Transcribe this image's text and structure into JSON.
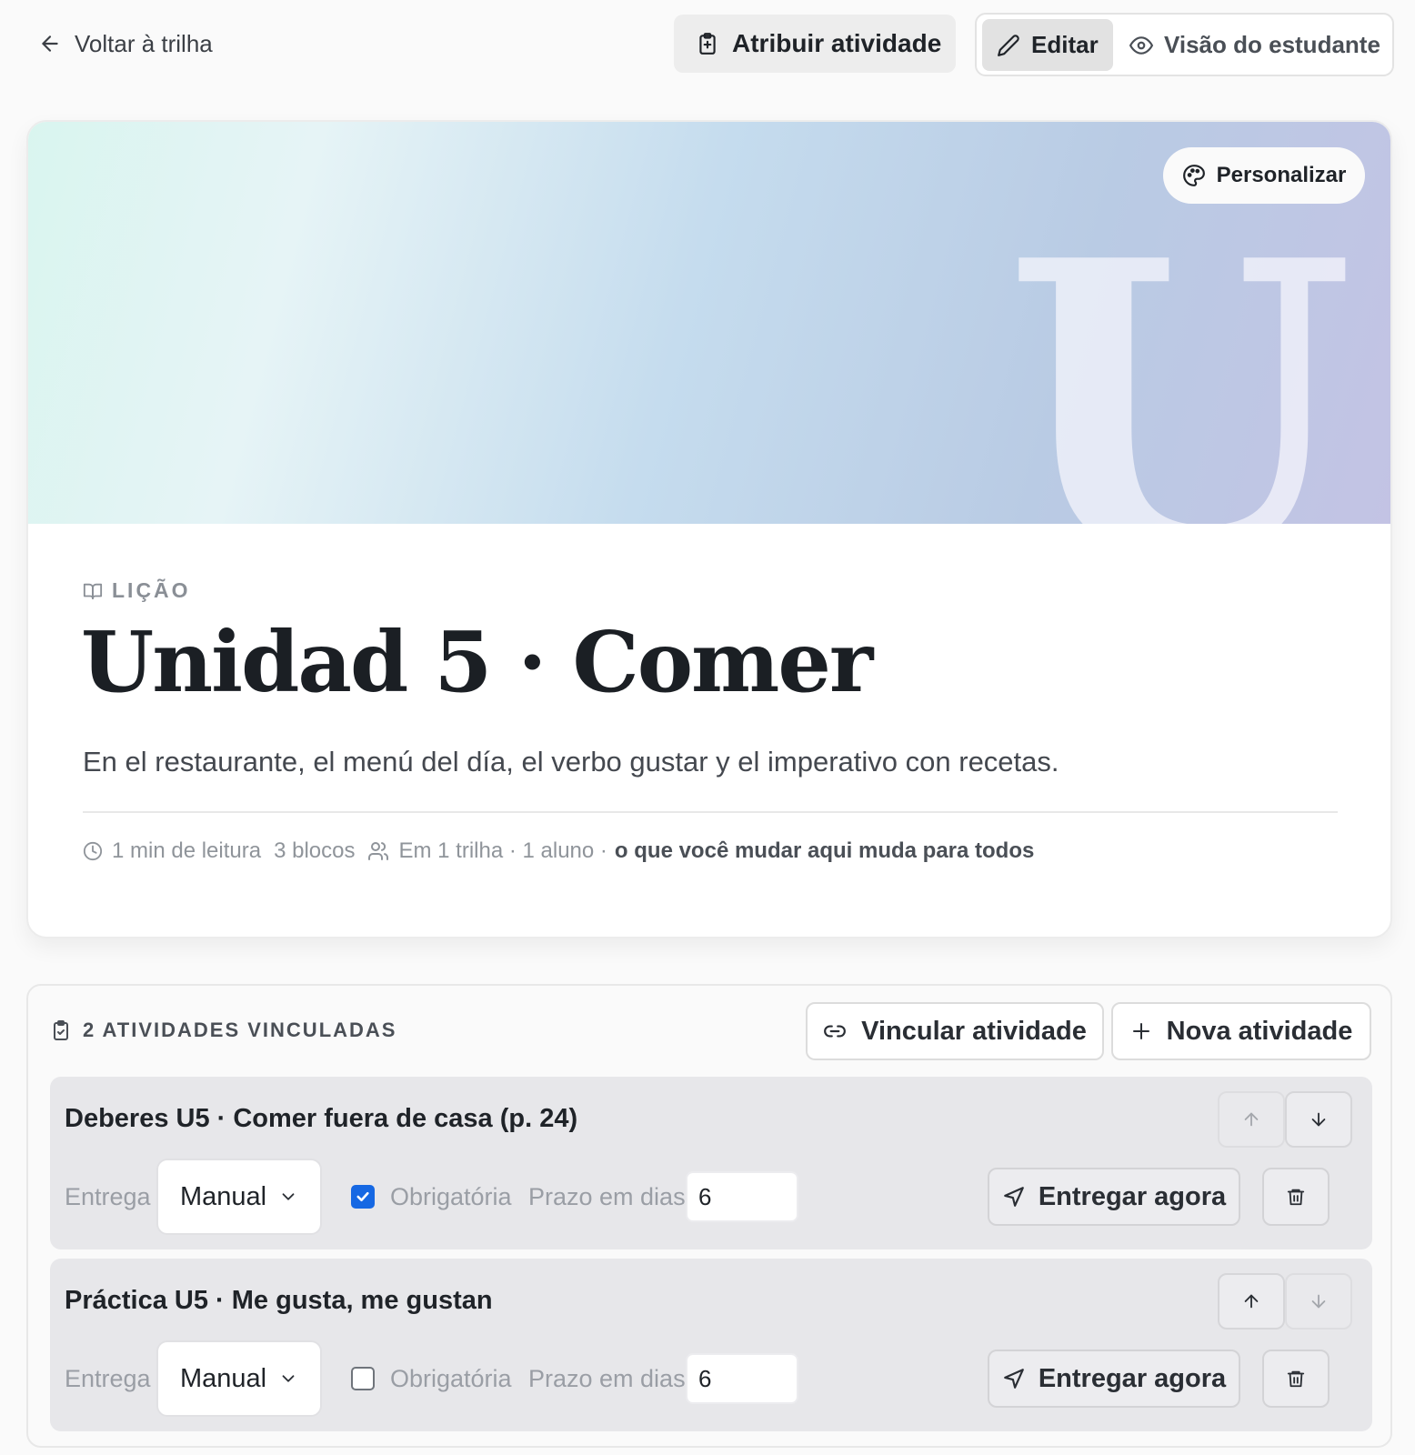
{
  "topbar": {
    "back_label": "Voltar à trilha",
    "back_icon": "arrow-left-icon",
    "assign_label": "Atribuir atividade",
    "assign_icon": "clipboard-plus-icon",
    "mode": {
      "edit_label": "Editar",
      "edit_icon": "pencil-icon",
      "edit_active": true,
      "student_label": "Visão do estudante",
      "student_icon": "eye-icon"
    }
  },
  "lesson": {
    "banner_letter": "U",
    "customize_label": "Personalizar",
    "customize_icon": "palette-icon",
    "kind_label": "LIÇÃO",
    "kind_icon": "book-open-icon",
    "title": "Unidad 5 · Comer",
    "subtitle": "En el restaurante, el menú del día, el verbo gustar y el imperativo con recetas.",
    "meta": {
      "reading_time": "1 min de leitura",
      "blocks": "3 blocos",
      "usage": "Em 1 trilha · 1 aluno ·",
      "warning": "o que você mudar aqui muda para todos"
    },
    "colors": {
      "banner_start": "#d9f5ef",
      "banner_end": "#c3c3e4"
    }
  },
  "activities": {
    "heading": "2 ATIVIDADES VINCULADAS",
    "heading_icon": "clipboard-check-icon",
    "link_label": "Vincular atividade",
    "link_icon": "link-icon",
    "new_label": "Nova atividade",
    "new_icon": "plus-icon",
    "items": [
      {
        "title": "Deberes U5 · Comer fuera de casa (p. 24)",
        "up_enabled": false,
        "down_enabled": true,
        "delivery_label": "Entrega",
        "delivery_value": "Manual",
        "required": true,
        "required_label": "Obrigatória",
        "deadline_label": "Prazo em dias",
        "deadline_value": "6",
        "deliver_label": "Entregar agora"
      },
      {
        "title": "Práctica U5 · Me gusta, me gustan",
        "up_enabled": true,
        "down_enabled": false,
        "delivery_label": "Entrega",
        "delivery_value": "Manual",
        "required": false,
        "required_label": "Obrigatória",
        "deadline_label": "Prazo em dias",
        "deadline_value": "6",
        "deliver_label": "Entregar agora"
      }
    ],
    "colors": {
      "checkbox_checked": "#1668e3"
    }
  }
}
